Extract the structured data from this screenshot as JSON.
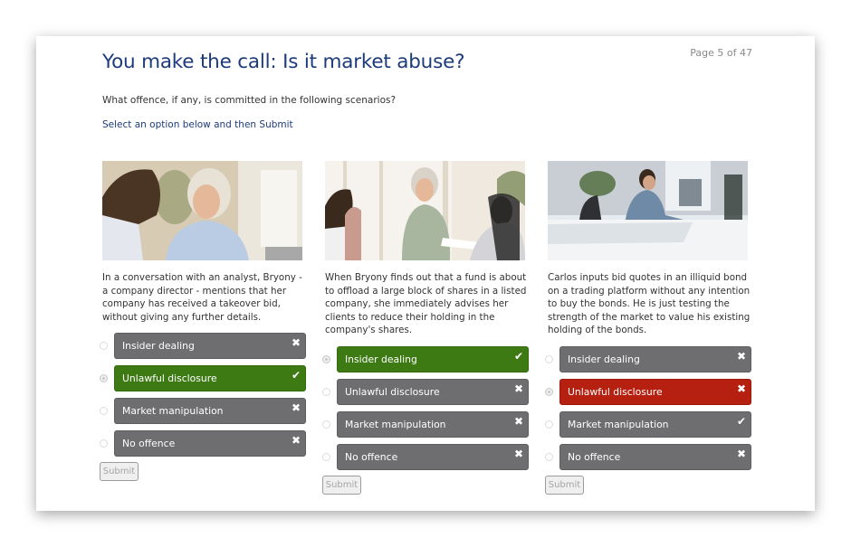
{
  "page_indicator": "Page 5 of 47",
  "title": "You make the call: Is it market abuse?",
  "subtitle": "What offence, if any, is committed in the following scenarios?",
  "instruction": "Select an option below and then Submit",
  "colors": {
    "title": "#1c3b7a",
    "option_default": "#6e6e70",
    "option_correct": "#3d7a14",
    "option_wrong": "#b52010"
  },
  "scenarios": [
    {
      "image_alt": "Two people in conversation: a man and an older woman with white hair",
      "description": "In a conversation with an analyst, Bryony - a company director - mentions that her company has received a takeover bid, without giving any further details.",
      "options": [
        {
          "label": "Insider dealing",
          "state": "default",
          "selected": false,
          "icon": "cross-icon",
          "glyph": "✖"
        },
        {
          "label": "Unlawful disclosure",
          "state": "correct",
          "selected": true,
          "icon": "check-icon",
          "glyph": "✔"
        },
        {
          "label": "Market manipulation",
          "state": "default",
          "selected": false,
          "icon": "cross-icon",
          "glyph": "✖"
        },
        {
          "label": "No offence",
          "state": "default",
          "selected": false,
          "icon": "cross-icon",
          "glyph": "✖"
        }
      ],
      "submit_label": "Submit"
    },
    {
      "image_alt": "Older woman handing documents to colleagues in a meeting",
      "description": "When Bryony finds out that a fund is about to offload a large block of shares in a listed company, she immediately advises her clients to reduce their holding in the company's shares.",
      "options": [
        {
          "label": "Insider dealing",
          "state": "correct",
          "selected": true,
          "icon": "check-icon",
          "glyph": "✔"
        },
        {
          "label": "Unlawful disclosure",
          "state": "default",
          "selected": false,
          "icon": "cross-icon",
          "glyph": "✖"
        },
        {
          "label": "Market manipulation",
          "state": "default",
          "selected": false,
          "icon": "cross-icon",
          "glyph": "✖"
        },
        {
          "label": "No offence",
          "state": "default",
          "selected": false,
          "icon": "cross-icon",
          "glyph": "✖"
        }
      ],
      "submit_label": "Submit"
    },
    {
      "image_alt": "Man working at a computer in a bright office",
      "description": "Carlos inputs bid quotes in an illiquid bond on a trading platform without any intention to buy the bonds. He is just testing the strength of the market to value his existing holding of the bonds.",
      "options": [
        {
          "label": "Insider dealing",
          "state": "default",
          "selected": false,
          "icon": "cross-icon",
          "glyph": "✖"
        },
        {
          "label": "Unlawful disclosure",
          "state": "wrong",
          "selected": true,
          "icon": "cross-icon",
          "glyph": "✖"
        },
        {
          "label": "Market manipulation",
          "state": "default",
          "selected": false,
          "icon": "check-icon",
          "glyph": "✔"
        },
        {
          "label": "No offence",
          "state": "default",
          "selected": false,
          "icon": "cross-icon",
          "glyph": "✖"
        }
      ],
      "submit_label": "Submit"
    }
  ]
}
